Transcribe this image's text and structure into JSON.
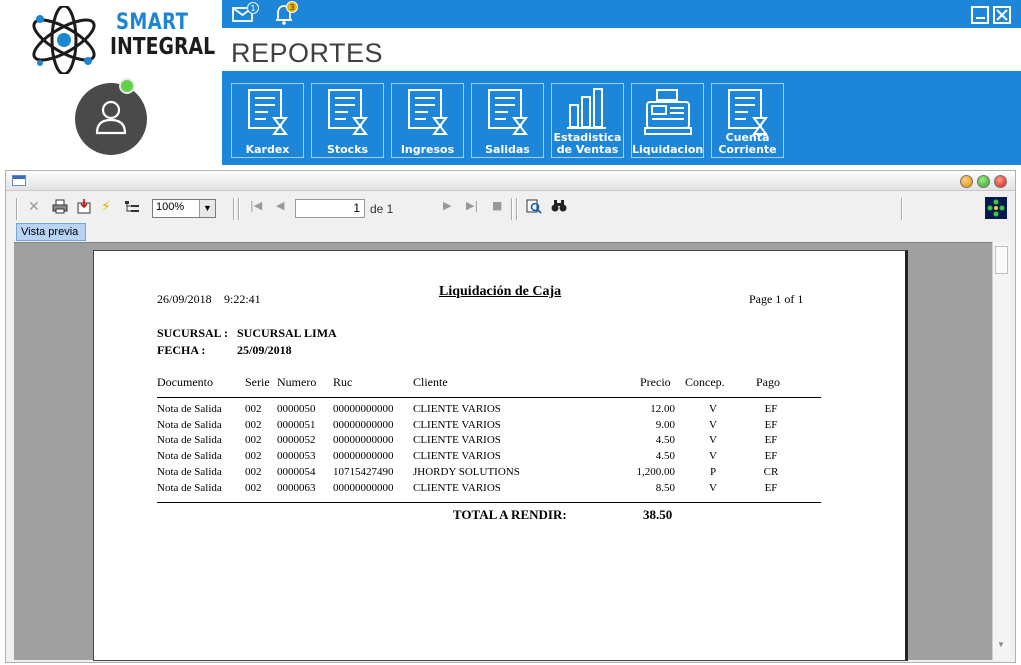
{
  "app": {
    "logo_line1": "SMART",
    "logo_line2": "INTEGRAL",
    "page_title": "REPORTES",
    "mail_badge": "1",
    "bell_badge": "3"
  },
  "ribbon": {
    "buttons": [
      {
        "label": "Kardex",
        "icon": "report-hourglass-icon"
      },
      {
        "label": "Stocks",
        "icon": "report-hourglass-icon"
      },
      {
        "label": "Ingresos",
        "icon": "report-hourglass-icon"
      },
      {
        "label": "Salidas",
        "icon": "report-hourglass-icon"
      },
      {
        "label": "Estadistica de Ventas",
        "icon": "bar-chart-icon"
      },
      {
        "label": "Liquidacion",
        "icon": "cash-register-icon"
      },
      {
        "label": "Cuenta Corriente",
        "icon": "report-hourglass-icon"
      }
    ]
  },
  "viewer": {
    "zoom": "100%",
    "current_page": "1",
    "of_label": "de 1",
    "preview_tab": "Vista previa"
  },
  "report": {
    "title": "Liquidación de Caja",
    "date": "26/09/2018",
    "time": "9:22:41",
    "page_label": "Page 1 of 1",
    "branch_label": "SUCURSAL :",
    "branch_value": "SUCURSAL LIMA",
    "date_label": "FECHA :",
    "date_value": "25/09/2018",
    "columns": [
      "Documento",
      "Serie",
      "Numero",
      "Ruc",
      "Cliente",
      "Precio",
      "Concep.",
      "Pago"
    ],
    "rows": [
      [
        "Nota de Salida",
        "002",
        "0000050",
        "00000000000",
        "CLIENTE VARIOS",
        "12.00",
        "V",
        "EF"
      ],
      [
        "Nota de Salida",
        "002",
        "0000051",
        "00000000000",
        "CLIENTE VARIOS",
        "9.00",
        "V",
        "EF"
      ],
      [
        "Nota de Salida",
        "002",
        "0000052",
        "00000000000",
        "CLIENTE VARIOS",
        "4.50",
        "V",
        "EF"
      ],
      [
        "Nota de Salida",
        "002",
        "0000053",
        "00000000000",
        "CLIENTE VARIOS",
        "4.50",
        "V",
        "EF"
      ],
      [
        "Nota de Salida",
        "002",
        "0000054",
        "10715427490",
        "JHORDY SOLUTIONS",
        "1,200.00",
        "P",
        "CR"
      ],
      [
        "Nota de Salida",
        "002",
        "0000063",
        "00000000000",
        "CLIENTE VARIOS",
        "8.50",
        "V",
        "EF"
      ]
    ],
    "total_label": "TOTAL  A RENDIR:",
    "total_value": "38.50"
  },
  "colors": {
    "brand_blue": "#1e86d8",
    "online_dot": "#62d14a"
  }
}
